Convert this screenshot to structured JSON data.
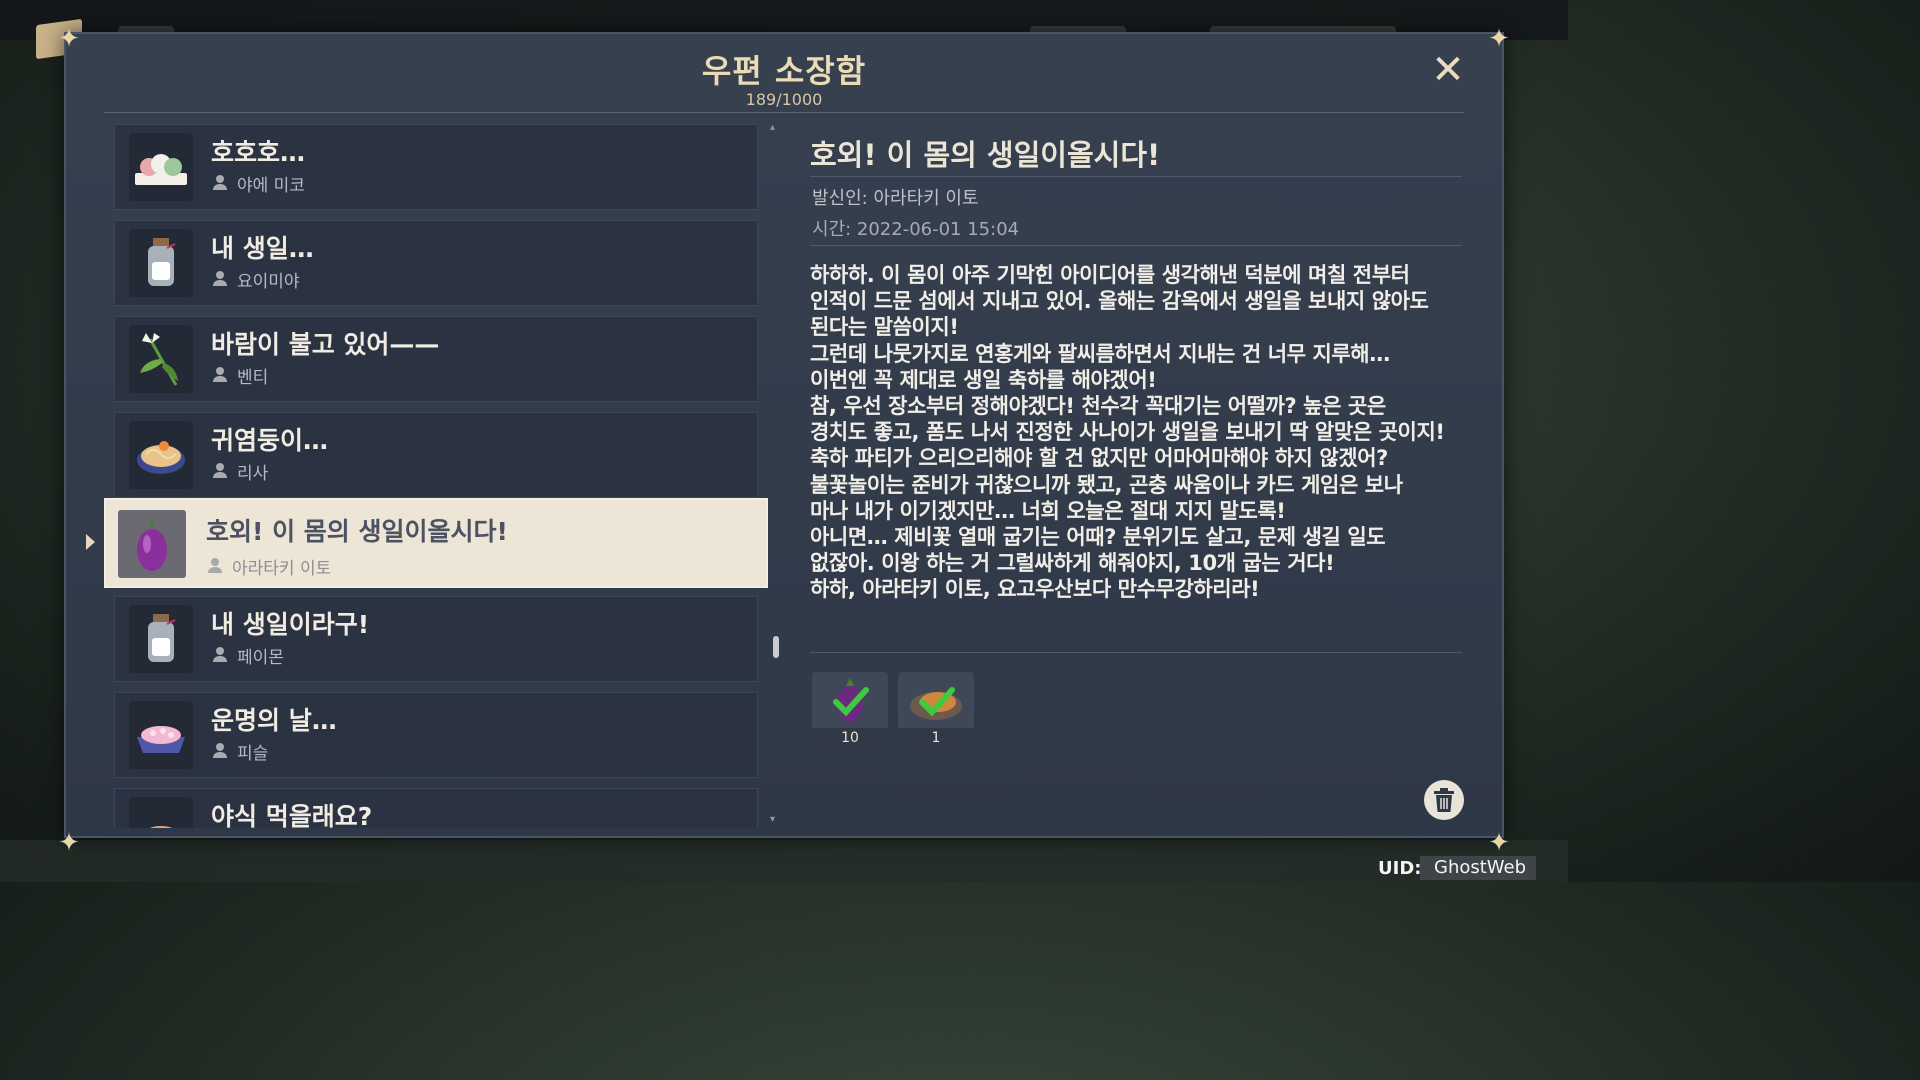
{
  "window": {
    "title": "우편 소장함",
    "count": "189/1000",
    "close_icon": "close-icon"
  },
  "mail_list": [
    {
      "title": "호호호…",
      "sender": "야에 미코",
      "icon": "dango-icon"
    },
    {
      "title": "내 생일…",
      "sender": "요이미야",
      "icon": "jar-icon"
    },
    {
      "title": "바람이 불고 있어——",
      "sender": "벤티",
      "icon": "cecilia-flower-icon"
    },
    {
      "title": "귀염둥이…",
      "sender": "리사",
      "icon": "noodle-bowl-icon"
    },
    {
      "title": "호외! 이 몸의 생일이올시다!",
      "sender": "아라타키 이토",
      "icon": "eggplant-icon",
      "selected": true
    },
    {
      "title": "내 생일이라구!",
      "sender": "페이몬",
      "icon": "jar-icon"
    },
    {
      "title": "운명의 날…",
      "sender": "피슬",
      "icon": "cake-icon"
    },
    {
      "title": "야식 먹을래요?",
      "sender": "",
      "icon": "dish-icon"
    }
  ],
  "detail": {
    "title": "호외! 이 몸의 생일이올시다!",
    "sender": "발신인: 아라타키 이토",
    "time": "시간: 2022-06-01 15:04",
    "body": "하하하. 이 몸이 아주 기막힌 아이디어를 생각해낸 덕분에 며칠 전부터\n인적이 드문 섬에서 지내고 있어. 올해는 감옥에서 생일을 보내지 않아도\n된다는 말씀이지!\n그런데 나뭇가지로 연홍게와 팔씨름하면서 지내는 건 너무 지루해…\n이번엔 꼭 제대로 생일 축하를 해야겠어!\n참, 우선 장소부터 정해야겠다! 천수각 꼭대기는 어떨까? 높은 곳은\n경치도 좋고, 폼도 나서 진정한 사나이가 생일을 보내기 딱 알맞은 곳이지!\n축하 파티가 으리으리해야 할 건 없지만 어마어마해야 하지 않겠어?\n불꽃놀이는 준비가 귀찮으니까 됐고, 곤충 싸움이나 카드 게임은 보나\n마나 내가 이기겠지만… 너희 오늘은 절대 지지 말도록!\n아니면… 제비꽃 열매 굽기는 어때? 분위기도 살고, 문제 생길 일도\n없잖아. 이왕 하는 거 그럴싸하게 해줘야지, 10개 굽는 거다!\n하하, 아라타키 이토, 요고우산보다 만수무강하리라!"
  },
  "rewards": [
    {
      "count": "10",
      "icon": "eggplant-reward-icon",
      "claimed": true
    },
    {
      "count": "1",
      "icon": "grilled-dish-reward-icon",
      "claimed": true
    }
  ],
  "footer": {
    "uid_label": "UID:",
    "uid_value": "GhostWeb"
  },
  "colors": {
    "panel_bg": "#36404f",
    "item_bg": "#2b3342",
    "selected_bg": "#ede5d5",
    "title_gold": "#eadbb5",
    "check_green": "#3fc93f"
  }
}
